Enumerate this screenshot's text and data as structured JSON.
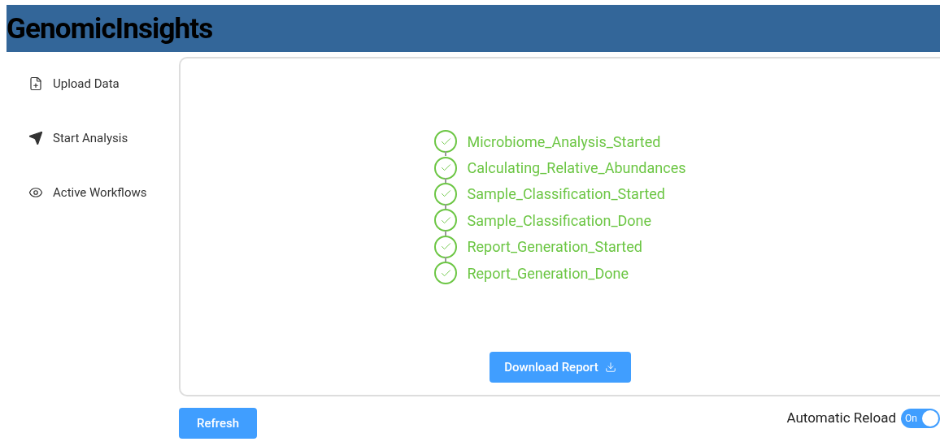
{
  "header": {
    "title": "GenomicInsights"
  },
  "sidebar": {
    "items": [
      {
        "label": "Upload Data"
      },
      {
        "label": "Start Analysis"
      },
      {
        "label": "Active Workflows"
      }
    ]
  },
  "workflow": {
    "steps": [
      {
        "label": "Microbiome_Analysis_Started",
        "done": true
      },
      {
        "label": "Calculating_Relative_Abundances",
        "done": true
      },
      {
        "label": "Sample_Classification_Started",
        "done": true
      },
      {
        "label": "Sample_Classification_Done",
        "done": true
      },
      {
        "label": "Report_Generation_Started",
        "done": true
      },
      {
        "label": "Report_Generation_Done",
        "done": true
      }
    ],
    "download_button": "Download Report"
  },
  "refresh_button": "Refresh",
  "auto_reload": {
    "label": "Automatic Reload",
    "on": true,
    "state_text": "On"
  }
}
